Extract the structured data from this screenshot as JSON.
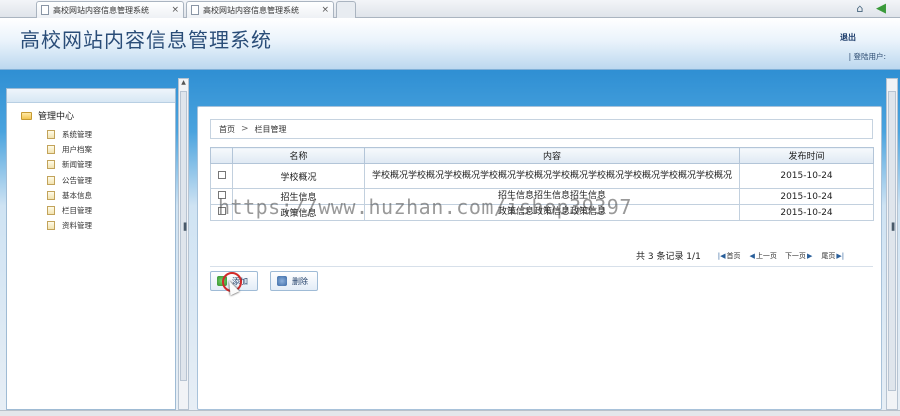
{
  "browser": {
    "tabs": [
      {
        "title": "高校网站内容信息管理系统"
      },
      {
        "title": "高校网站内容信息管理系统"
      },
      {
        "title": ""
      }
    ],
    "close_glyph": "×"
  },
  "header": {
    "title": "高校网站内容信息管理系统",
    "logout": "退出",
    "current_user": "| 登陆用户:"
  },
  "sidebar": {
    "root_label": "管理中心",
    "items": [
      {
        "label": "系统管理"
      },
      {
        "label": "用户档案"
      },
      {
        "label": "新闻管理"
      },
      {
        "label": "公告管理"
      },
      {
        "label": "基本信息"
      },
      {
        "label": "栏目管理"
      },
      {
        "label": "资料管理"
      }
    ]
  },
  "breadcrumb": {
    "home": "首页",
    "separator": ">",
    "current": "栏目管理"
  },
  "table": {
    "headers": [
      "",
      "名称",
      "内容",
      "发布时间"
    ],
    "rows": [
      {
        "name": "学校概况",
        "content": "学校概况学校概况学校概况学校概况学校概况学校概况学校概况学校概况学校概况学校概况",
        "date": "2015-10-24"
      },
      {
        "name": "招生信息",
        "content": "招生信息招生信息招生信息",
        "date": "2015-10-24"
      },
      {
        "name": "政策信息",
        "content": "政策信息政策信息政策信息",
        "date": "2015-10-24"
      }
    ]
  },
  "pager": {
    "summary": "共 3 条记录 1/1",
    "first": "首页",
    "prev": "上一页",
    "next": "下一页",
    "last": "尾页"
  },
  "actions": {
    "add": "添加",
    "delete": "删除"
  },
  "watermark": "https://www.huzhan.com/ishop39397",
  "colors": {
    "header_title": "#2a4d78",
    "accent_blue": "#2f8fd3"
  }
}
